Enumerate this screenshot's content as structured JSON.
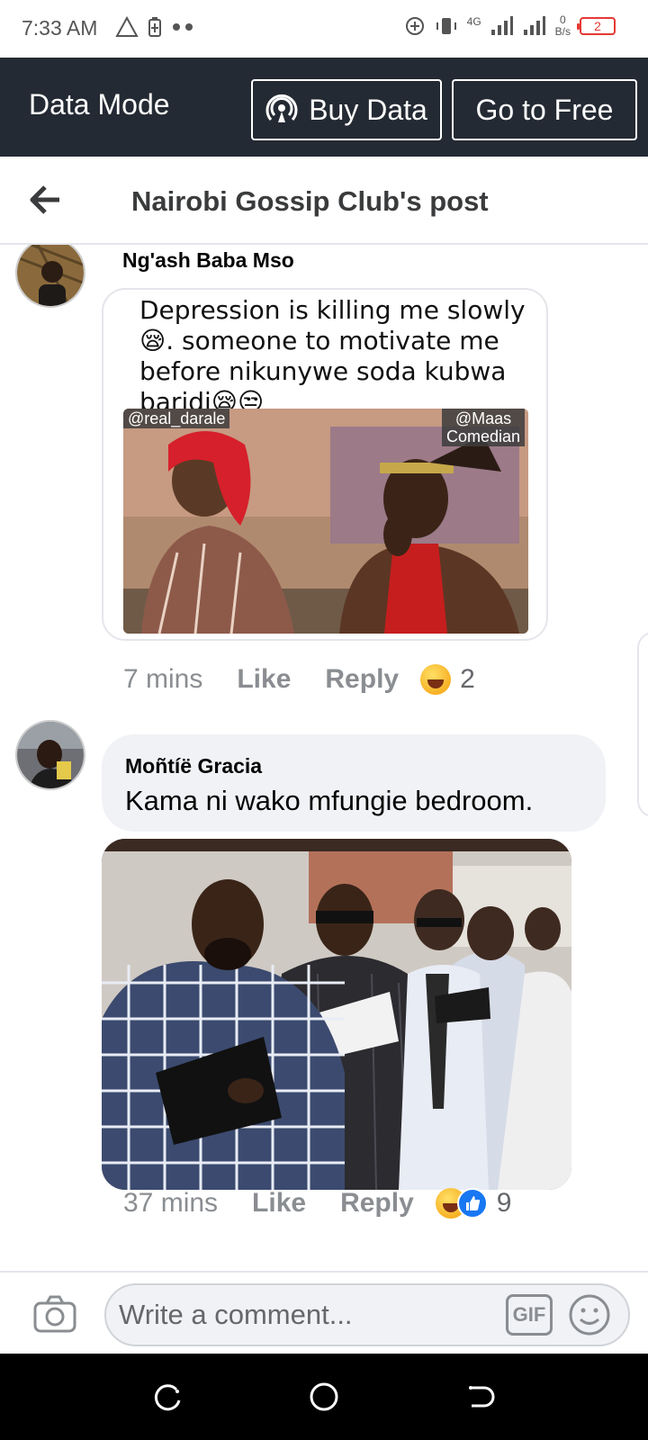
{
  "status_bar": {
    "time": "7:33 AM",
    "network": "4G",
    "speed_value": "0",
    "speed_unit": "B/s",
    "battery_level": "2",
    "battery_color": "#e53935"
  },
  "data_mode_bar": {
    "label": "Data Mode",
    "buy_data_label": "Buy Data",
    "go_free_label": "Go to Free",
    "background": "#242a33"
  },
  "header": {
    "title": "Nairobi Gossip Club's post"
  },
  "comments": [
    {
      "author": "Ng'ash Baba Mso",
      "meme": {
        "text": "Depression is killing me slowly 😪. someone to motivate me before nikunywe soda kubwa baridi😪😒",
        "tag_left": "@real_darale",
        "tag_right_line1": "@Maas",
        "tag_right_line2": "Comedian"
      },
      "time": "7 mins",
      "like_label": "Like",
      "reply_label": "Reply",
      "reaction_icons": [
        "laugh-emoji"
      ],
      "reaction_count": "2"
    },
    {
      "author": "Moñtíë Gracia",
      "text": "Kama ni wako mfungie bedroom.",
      "time": "37 mins",
      "like_label": "Like",
      "reply_label": "Reply",
      "reaction_icons": [
        "laugh-emoji",
        "like-emoji"
      ],
      "reaction_count": "9"
    }
  ],
  "composer": {
    "placeholder": "Write a comment...",
    "gif_label": "GIF"
  },
  "colors": {
    "meta_text": "#8a8d91",
    "bubble": "#f0f2f5",
    "facebook_blue": "#1877f2"
  }
}
